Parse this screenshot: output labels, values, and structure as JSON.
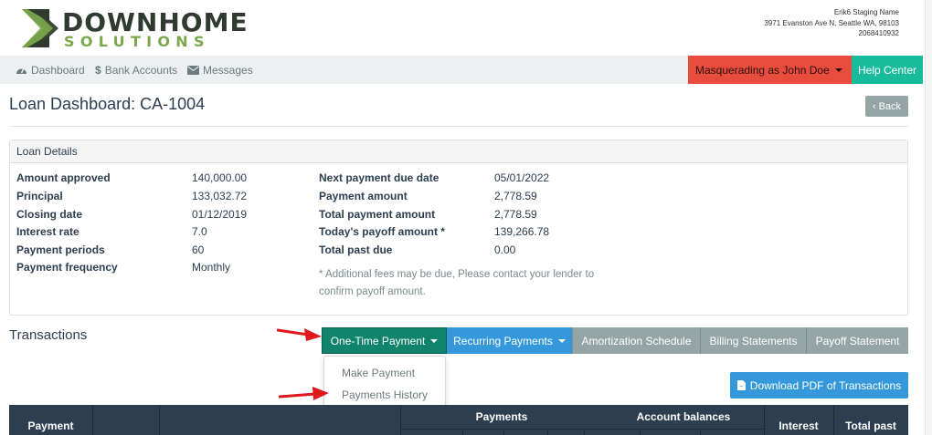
{
  "brand": {
    "line1": "DOWNHOME",
    "line2": "SOLUTIONS"
  },
  "company": {
    "name": "Erik6 Staging Name",
    "address": "3971 Evanston Ave N, Seattle WA, 98103",
    "phone": "2068410932"
  },
  "nav": {
    "items": [
      {
        "label": "Dashboard",
        "icon": "dashboard-icon"
      },
      {
        "label": "Bank Accounts",
        "icon": "dollar-icon"
      },
      {
        "label": "Messages",
        "icon": "envelope-icon"
      }
    ],
    "masquerade": "Masquerading as John Doe",
    "help": "Help Center"
  },
  "page": {
    "title": "Loan Dashboard: CA-1004",
    "back": "Back"
  },
  "loan": {
    "heading": "Loan Details",
    "left": [
      {
        "label": "Amount approved",
        "value": "140,000.00"
      },
      {
        "label": "Principal",
        "value": "133,032.72"
      },
      {
        "label": "Closing date",
        "value": "01/12/2019"
      },
      {
        "label": "Interest rate",
        "value": "7.0"
      },
      {
        "label": "Payment periods",
        "value": "60"
      },
      {
        "label": "Payment frequency",
        "value": "Monthly"
      }
    ],
    "right": [
      {
        "label": "Next payment due date",
        "value": "05/01/2022"
      },
      {
        "label": "Payment amount",
        "value": "2,778.59"
      },
      {
        "label": "Total payment amount",
        "value": "2,778.59"
      },
      {
        "label": "Today's payoff amount *",
        "value": "139,266.78"
      },
      {
        "label": "Total past due",
        "value": "0.00"
      }
    ],
    "note": "* Additional fees may be due, Please contact your lender to confirm payoff amount."
  },
  "transactions": {
    "title": "Transactions",
    "buttons": {
      "one_time": "One-Time Payment",
      "recurring": "Recurring Payments",
      "amortization": "Amortization Schedule",
      "billing": "Billing Statements",
      "payoff": "Payoff Statement"
    },
    "dropdown": [
      "Make Payment",
      "Payments History"
    ],
    "download": "Download PDF of Transactions",
    "table_headers": {
      "payment": "Payment",
      "payments": "Payments",
      "account_balances": "Account balances",
      "interest": "Interest",
      "total_past": "Total past"
    }
  },
  "colors": {
    "nav_bg": "#ecf0f1",
    "masquerade": "#e74c3c",
    "help": "#18bc9c",
    "primary_green": "#10846a",
    "info_blue": "#3498db",
    "gray_btn": "#95a5a6",
    "table_head": "#2c3e50",
    "brand_dark": "#2e3b2e",
    "brand_green": "#7ba84a",
    "annotation_arrow": "#e0191f"
  }
}
